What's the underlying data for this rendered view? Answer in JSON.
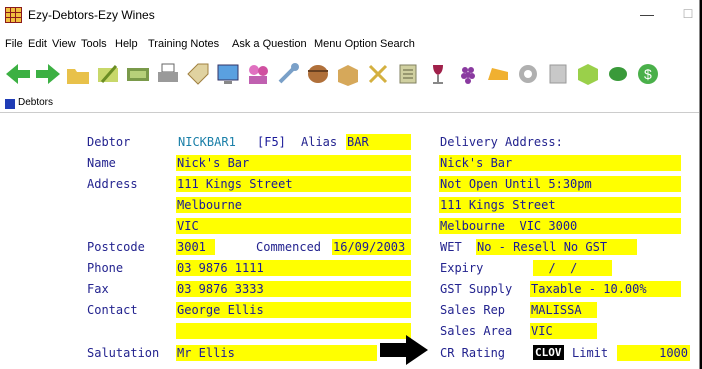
{
  "window": {
    "title": "Ezy-Debtors-Ezy Wines",
    "minimize": "—",
    "maximize": "☐"
  },
  "menu": [
    "File",
    "Edit",
    "View",
    "Tools",
    "Help",
    "Training Notes",
    "Ask a Question",
    "Menu Option Search"
  ],
  "tab": {
    "label": "Debtors"
  },
  "toolbar_icons": [
    "back-arrow-icon",
    "forward-arrow-icon",
    "folder-open-icon",
    "edit-icon",
    "money-icon",
    "print-icon",
    "tag-icon",
    "screen-icon",
    "users-icon",
    "wrench-icon",
    "barrel-icon",
    "box-icon",
    "tools-icon",
    "ledger-icon",
    "wine-glass-icon",
    "grapes-icon",
    "cheese-icon",
    "gear-icon",
    "document-icon",
    "cube-icon",
    "leaf-icon",
    "dollar-icon"
  ],
  "form": {
    "debtor_label": "Debtor",
    "debtor_value": "NICKBAR1",
    "f5": "[F5]",
    "alias_label": "Alias",
    "alias_value": "BAR",
    "name_label": "Name",
    "name_value": "Nick's Bar",
    "address_label": "Address",
    "address1": "111 Kings Street",
    "address2": "Melbourne",
    "address3": "VIC",
    "postcode_label": "Postcode",
    "postcode_value": "3001",
    "commenced_label": "Commenced",
    "commenced_value": "16/09/2003",
    "phone_label": "Phone",
    "phone_value": "03 9876 1111",
    "fax_label": "Fax",
    "fax_value": "03 9876 3333",
    "contact_label": "Contact",
    "contact_value": "George Ellis",
    "contact2_value": "",
    "salutation_label": "Salutation",
    "salutation_value": "Mr Ellis",
    "delivery_label": "Delivery Address:",
    "delivery1": "Nick's Bar",
    "delivery2": "Not Open Until 5:30pm",
    "delivery3": "111 Kings Street",
    "delivery4": "Melbourne  VIC 3000",
    "wet_label": "WET",
    "wet_value": "No - Resell No GST",
    "expiry_label": "Expiry",
    "expiry_value": "  /  /",
    "gst_label": "GST Supply",
    "gst_value": "Taxable - 10.00%",
    "salesrep_label": "Sales Rep",
    "salesrep_value": "MALISSA",
    "salesarea_label": "Sales Area",
    "salesarea_value": "VIC",
    "crrating_label": "CR Rating",
    "crrating_value": "CLOV",
    "limit_label": "Limit",
    "limit_value": "1000"
  }
}
